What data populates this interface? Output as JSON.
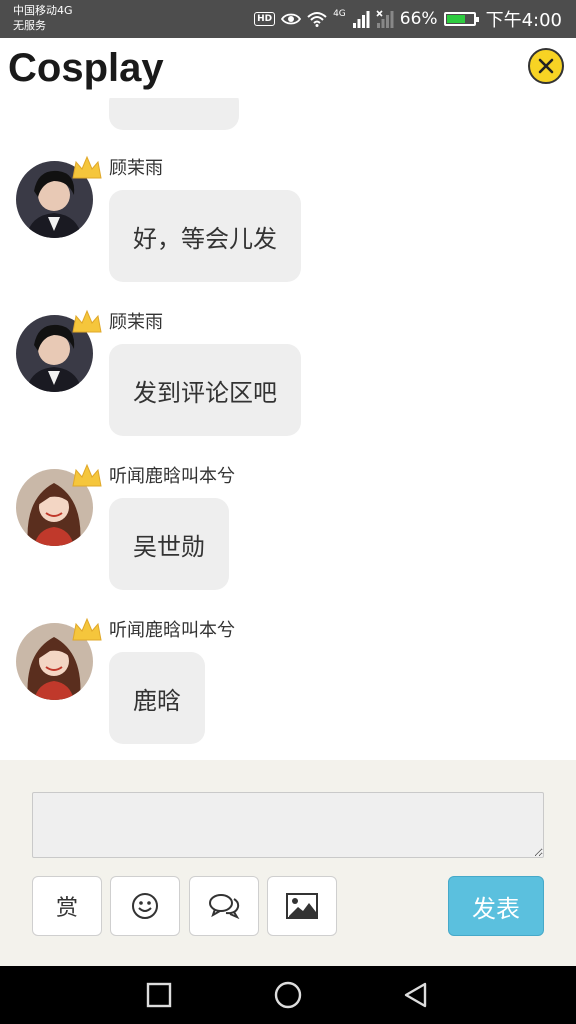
{
  "status_bar": {
    "carrier_line1": "中国移动4G",
    "carrier_line2": "无服务",
    "hd": "HD",
    "network": "4G",
    "battery_text": "66%",
    "battery_level": 0.66,
    "time": "下午4:00"
  },
  "header": {
    "title": "Cosplay",
    "close_icon": "close-circle-icon",
    "accent": "#f7d324"
  },
  "messages": [
    {
      "name": "顾茉雨",
      "text": "好，等会儿发",
      "avatar": "male-avatar"
    },
    {
      "name": "顾茉雨",
      "text": "发到评论区吧",
      "avatar": "male-avatar"
    },
    {
      "name": "听闻鹿晗叫本兮",
      "text": "吴世勋",
      "avatar": "female-avatar"
    },
    {
      "name": "听闻鹿晗叫本兮",
      "text": "鹿晗",
      "avatar": "female-avatar"
    }
  ],
  "composer": {
    "input_value": "",
    "reward_label": "赏",
    "send_label": "发表",
    "send_color": "#5bc0de",
    "tools": [
      "reward-button",
      "emoji-icon",
      "chat-bubbles-icon",
      "image-icon"
    ]
  },
  "navbar": {
    "buttons": [
      "recent-apps-icon",
      "home-icon",
      "back-icon"
    ]
  }
}
